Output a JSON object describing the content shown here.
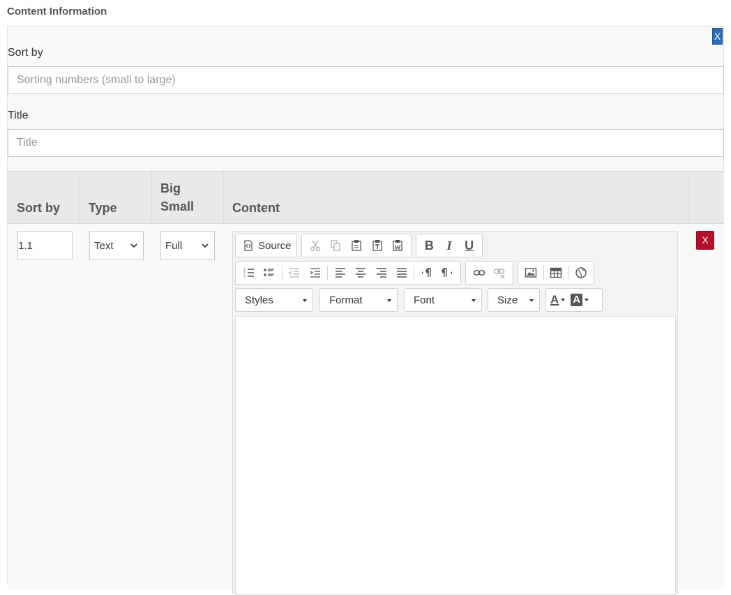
{
  "section_title": "Content Information",
  "close_label": "X",
  "sort_field": {
    "label": "Sort by",
    "placeholder": "Sorting numbers (small to large)"
  },
  "title_field": {
    "label": "Title",
    "placeholder": "Title"
  },
  "table": {
    "headers": {
      "sort": "Sort by",
      "type": "Type",
      "size_line1": "Big",
      "size_line2": "Small",
      "content": "Content"
    },
    "row": {
      "sort_value": "1.1",
      "type_value": "Text",
      "size_value": "Full",
      "delete_label": "X"
    }
  },
  "editor": {
    "source_label": "Source",
    "combos": {
      "styles": "Styles",
      "format": "Format",
      "font": "Font",
      "size": "Size"
    },
    "bold": "B",
    "italic": "I",
    "underline": "U",
    "text_color": "A",
    "bg_color": "A"
  },
  "colors": {
    "primary": "#2a6db5",
    "danger": "#b3112b",
    "header_bg": "#e9e9e9"
  }
}
